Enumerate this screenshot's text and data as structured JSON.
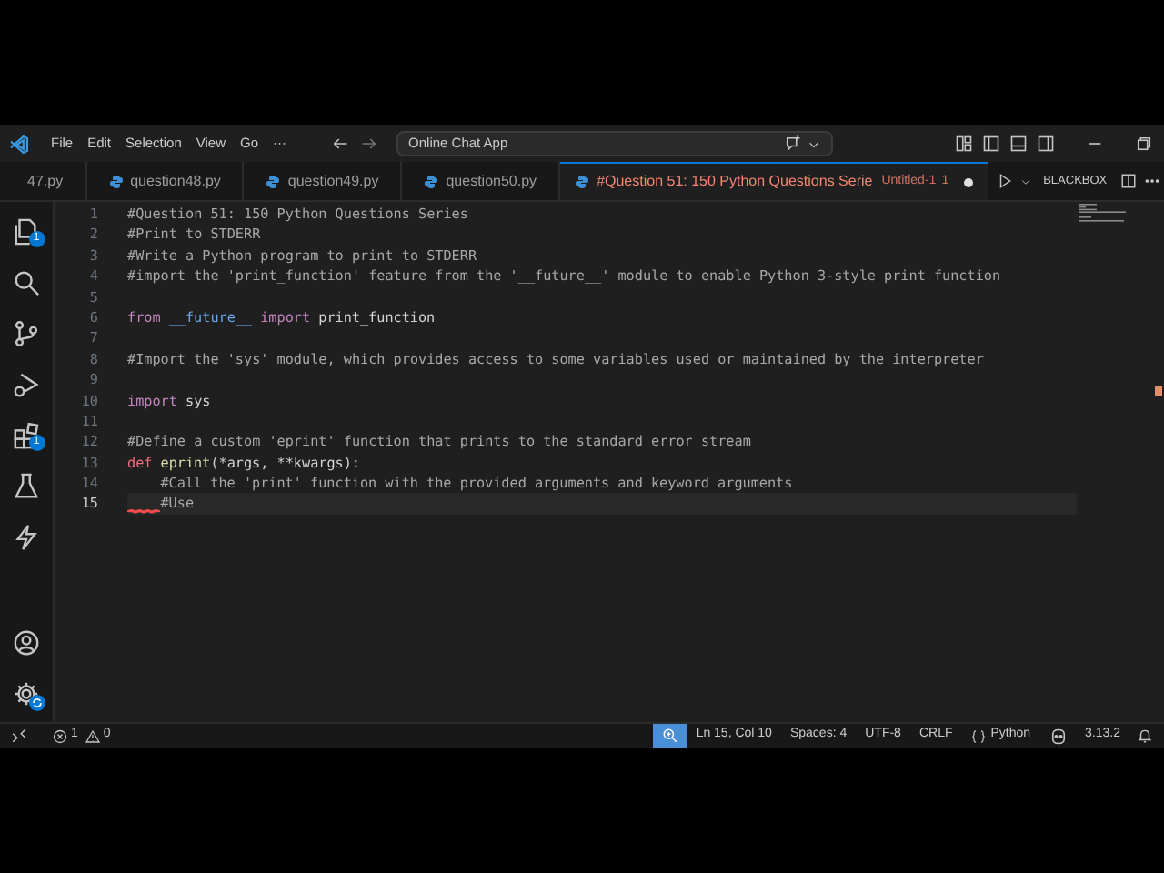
{
  "title_bar": {
    "menus": [
      "File",
      "Edit",
      "Selection",
      "View",
      "Go",
      "···"
    ],
    "command_center": "Online Chat App"
  },
  "activity_bar": {
    "items": [
      {
        "kind": "explorer",
        "badge": "1"
      },
      {
        "kind": "search"
      },
      {
        "kind": "source-control"
      },
      {
        "kind": "run"
      },
      {
        "kind": "extensions",
        "badge": "1"
      },
      {
        "kind": "testing"
      },
      {
        "kind": "lightning"
      }
    ],
    "bottom": [
      {
        "kind": "account"
      },
      {
        "kind": "settings"
      }
    ]
  },
  "tabs": [
    {
      "kind": "plain",
      "label": "47.py",
      "selected": false
    },
    {
      "kind": "python",
      "label": "question48.py",
      "selected": false
    },
    {
      "kind": "python",
      "label": "question49.py",
      "selected": false
    },
    {
      "kind": "python",
      "label": "question50.py",
      "selected": false
    },
    {
      "kind": "python",
      "label": "#Question 51: 150 Python Questions Serie",
      "description": "Untitled-1",
      "problems": "1",
      "dirty": true,
      "selected": true
    }
  ],
  "editor_actions": {
    "extension": "BLACKBOX"
  },
  "editor": {
    "lines": [
      {
        "number": "1",
        "tokens": [
          {
            "kind": "comment",
            "text": "#Question 51: 150 Python Questions Series"
          }
        ],
        "current": false
      },
      {
        "number": "2",
        "tokens": [
          {
            "kind": "comment",
            "text": "#Print to STDERR"
          }
        ],
        "current": false
      },
      {
        "number": "3",
        "tokens": [
          {
            "kind": "comment",
            "text": "#Write a Python program to print to STDERR"
          }
        ],
        "current": false
      },
      {
        "number": "4",
        "tokens": [
          {
            "kind": "comment",
            "text": "#import the 'print_function' feature from the '__future__' module to enable Python 3-style print function"
          }
        ],
        "current": false
      },
      {
        "number": "5",
        "current": false
      },
      {
        "number": "6",
        "tokens": [
          {
            "kind": "keyword",
            "text": "from"
          },
          {
            "kind": "module",
            "text": "__future__",
            "space": true
          },
          {
            "kind": "keyword",
            "text": "import",
            "space": true
          },
          {
            "kind": "plain",
            "text": " print_function"
          }
        ],
        "current": false
      },
      {
        "number": "7",
        "current": false
      },
      {
        "number": "8",
        "tokens": [
          {
            "kind": "comment",
            "text": "#Import the 'sys' module, which provides access to some variables used or maintained by the interpreter"
          }
        ],
        "current": false
      },
      {
        "number": "9",
        "current": false
      },
      {
        "number": "10",
        "tokens": [
          {
            "kind": "keyword",
            "text": "import"
          },
          {
            "kind": "plain",
            "text": " sys"
          }
        ],
        "current": false
      },
      {
        "number": "11",
        "current": false
      },
      {
        "number": "12",
        "tokens": [
          {
            "kind": "comment",
            "text": "#Define a custom 'eprint' function that prints to the standard error stream"
          }
        ],
        "current": false
      },
      {
        "number": "13",
        "tokens": [
          {
            "kind": "def",
            "text": "def"
          },
          {
            "kind": "function",
            "text": "eprint",
            "space": true
          },
          {
            "kind": "plain",
            "text": "(*args, **kwargs):"
          }
        ],
        "current": false
      },
      {
        "number": "14",
        "indented": true,
        "tokens": [
          {
            "kind": "comment",
            "text": "#Call the 'print' function with the provided arguments and keyword arguments"
          }
        ],
        "current": false
      },
      {
        "number": "15",
        "indented": true,
        "tokens": [
          {
            "kind": "comment",
            "text": "#Use"
          }
        ],
        "current": true,
        "error": true
      }
    ]
  },
  "status_bar": {
    "errors": "1",
    "warnings": "0",
    "position": "Ln 15, Col 10",
    "indentation": "Spaces: 4",
    "encoding": "UTF-8",
    "line_ending": "CRLF",
    "language": "Python",
    "version": "3.13.2"
  }
}
